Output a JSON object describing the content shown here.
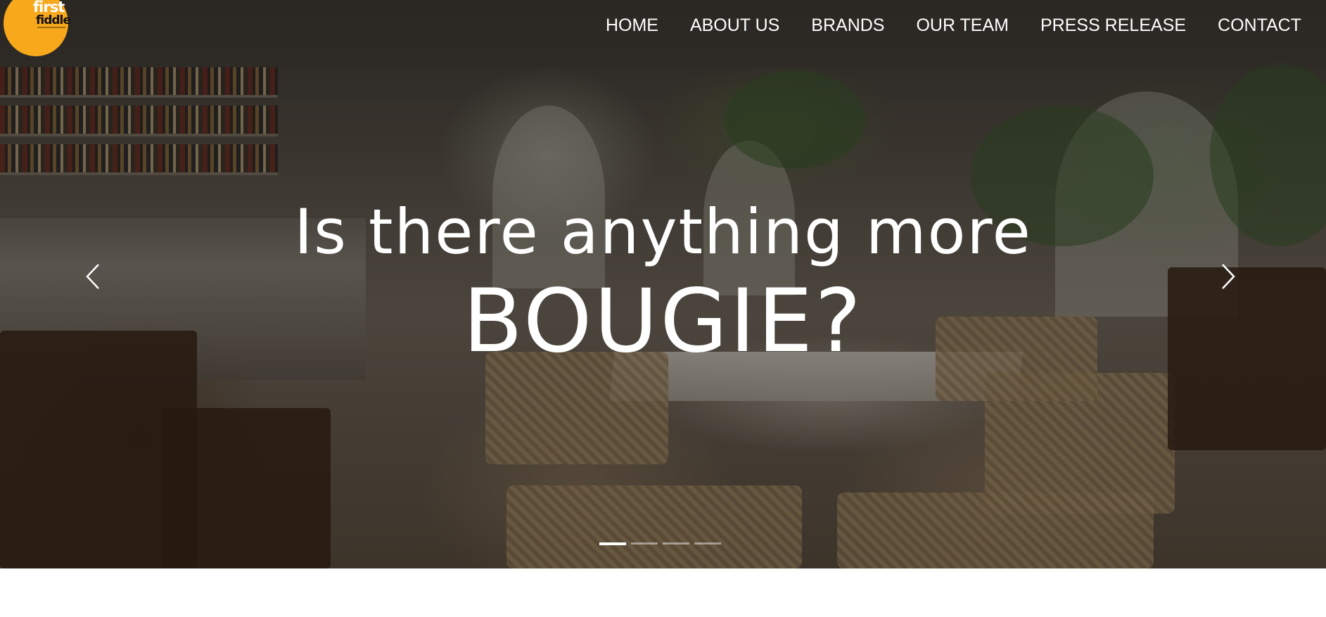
{
  "site": {
    "logo": {
      "line1": "first",
      "line2": "fiddle"
    },
    "nav": {
      "items": [
        "HOME",
        "ABOUT US",
        "BRANDS",
        "OUR TEAM",
        "PRESS RELEASE",
        "CONTACT"
      ]
    }
  },
  "hero": {
    "headline_line1": "Is there anything more",
    "headline_line2": "BOUGIE?",
    "prev_icon": "chevron-left-icon",
    "next_icon": "chevron-right-icon",
    "slides_total": 4,
    "active_slide": 1
  },
  "colors": {
    "logo_bg": "#f7a81b",
    "nav_text": "#ffffff"
  }
}
